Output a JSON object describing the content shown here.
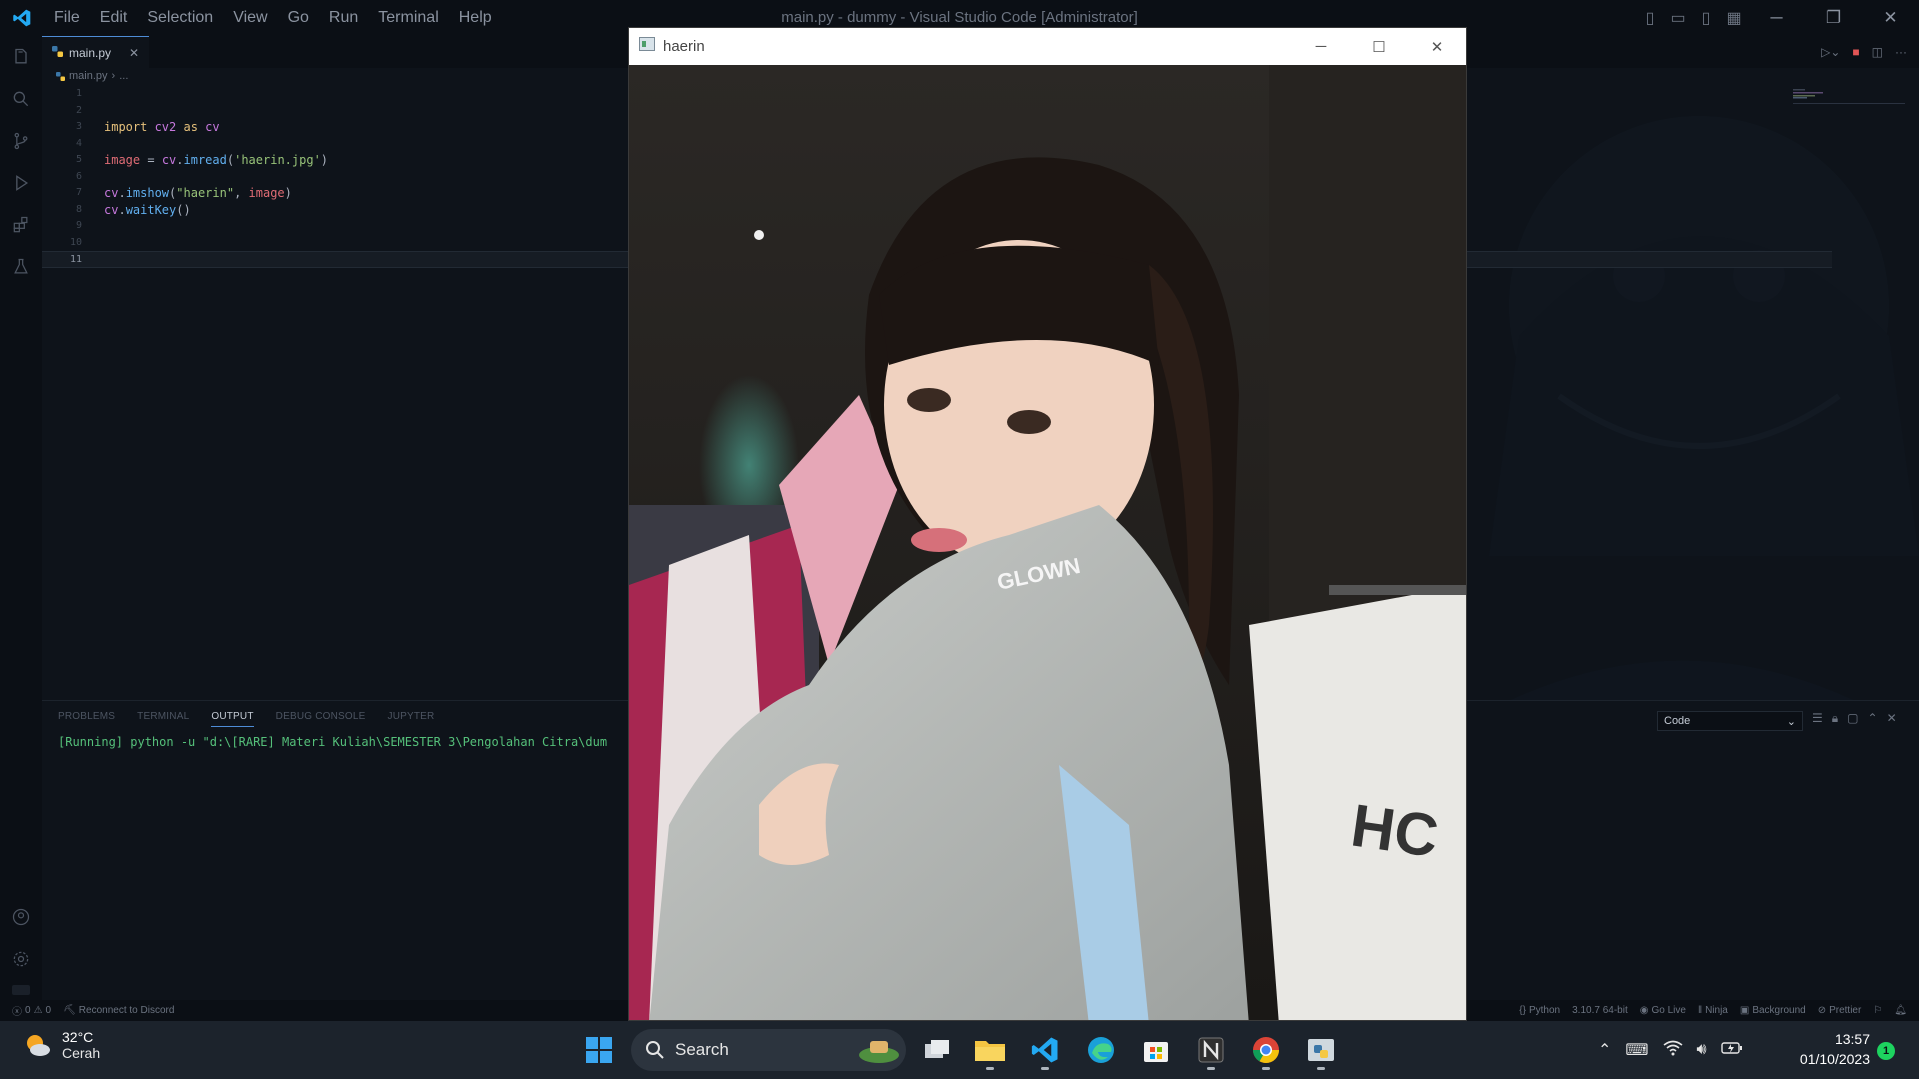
{
  "window": {
    "title": "main.py - dummy - Visual Studio Code [Administrator]",
    "menu": [
      "File",
      "Edit",
      "Selection",
      "View",
      "Go",
      "Run",
      "Terminal",
      "Help"
    ]
  },
  "editor": {
    "tab_label": "main.py",
    "breadcrumb": [
      "main.py",
      "..."
    ],
    "line_numbers": [
      "1",
      "2",
      "3",
      "4",
      "5",
      "6",
      "7",
      "8",
      "9",
      "10",
      "11"
    ],
    "code": {
      "l3": {
        "a": "import",
        "b": " cv2 ",
        "c": "as",
        "d": " cv"
      },
      "l5": {
        "a": "image",
        "b": " = ",
        "c": "cv",
        "d": ".",
        "e": "imread",
        "f": "(",
        "g": "'haerin.jpg'",
        "h": ")"
      },
      "l7": {
        "a": "cv",
        "b": ".",
        "c": "imshow",
        "d": "(",
        "e": "\"haerin\"",
        "f": ", ",
        "g": "image",
        "h": ")"
      },
      "l8": {
        "a": "cv",
        "b": ".",
        "c": "waitKey",
        "d": "()"
      }
    }
  },
  "panel": {
    "tabs": [
      "PROBLEMS",
      "TERMINAL",
      "OUTPUT",
      "DEBUG CONSOLE",
      "JUPYTER"
    ],
    "active_tab": "OUTPUT",
    "output_text": "[Running] python -u \"d:\\[RARE] Materi Kuliah\\SEMESTER 3\\Pengolahan Citra\\dum",
    "output_channel": "Code"
  },
  "statusbar": {
    "problems": "0",
    "warnings": "0",
    "discord": "Reconnect to Discord",
    "language": "Python",
    "interpreter": "3.10.7 64-bit",
    "golive": "Go Live",
    "ninja": "Ninja",
    "background": "Background",
    "prettier": "Prettier"
  },
  "image_window": {
    "title": "haerin",
    "jacket_text": "GLOWN",
    "bag_text": "HC"
  },
  "taskbar": {
    "weather_temp": "32°C",
    "weather_cond": "Cerah",
    "search_placeholder": "Search",
    "time": "13:57",
    "date": "01/10/2023",
    "notification_count": "1"
  },
  "colors": {
    "accent": "#4e8cd6",
    "vscode_blue": "#23a9f2",
    "output_green": "#55c07a"
  }
}
